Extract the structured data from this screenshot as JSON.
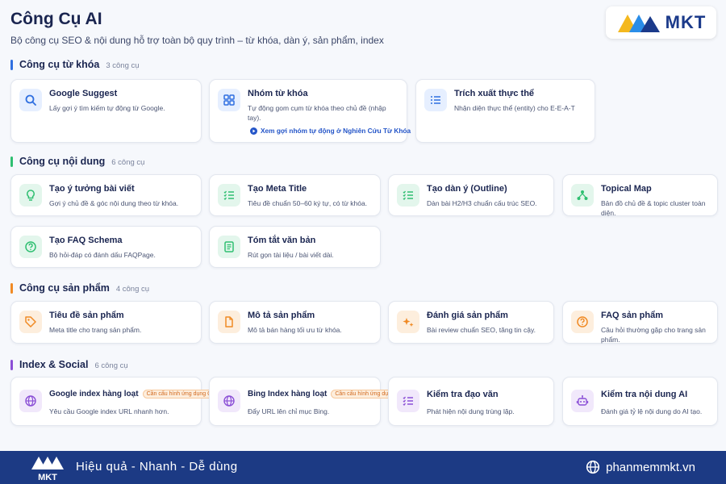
{
  "header": {
    "title": "Công Cụ AI",
    "subtitle": "Bộ công cụ SEO & nội dung hỗ trợ toàn bộ quy trình – từ khóa, dàn ý, sản phẩm, index",
    "logo_text": "MKT"
  },
  "colors": {
    "keyword": "#2f6fe0",
    "content": "#2fbf71",
    "product": "#f08a24",
    "index": "#8b4fd6",
    "footer_bg": "#1c3a84",
    "link": "#2455c8"
  },
  "sections": {
    "keyword": {
      "title": "Công cụ từ khóa",
      "count": "3 công cụ",
      "cards": [
        {
          "icon": "search-icon",
          "title": "Google Suggest",
          "desc": "Lấy gợi ý tìm kiếm tự động từ Google."
        },
        {
          "icon": "grid-icon",
          "title": "Nhóm từ khóa",
          "desc": "Tự động gom cụm từ khóa theo chủ đề (nhập tay).",
          "link": "Xem gợi nhóm tự động ở Nghiên Cứu Từ Khóa"
        },
        {
          "icon": "list-icon",
          "title": "Trích xuất thực thể",
          "desc": "Nhận diện thực thể (entity) cho E-E-A-T"
        }
      ]
    },
    "content": {
      "title": "Công cụ nội dung",
      "count": "6 công cụ",
      "cards": [
        {
          "icon": "lightbulb-icon",
          "title": "Tạo ý tưởng bài viết",
          "desc": "Gợi ý chủ đề & góc nội dung theo từ khóa."
        },
        {
          "icon": "checklist-icon",
          "title": "Tạo Meta Title",
          "desc": "Tiêu đề chuẩn 50–60 ký tự, có từ khóa."
        },
        {
          "icon": "checklist-icon",
          "title": "Tạo dàn ý (Outline)",
          "desc": "Dàn bài H2/H3 chuẩn cấu trúc SEO."
        },
        {
          "icon": "network-icon",
          "title": "Topical Map",
          "desc": "Bản đồ chủ đề & topic cluster toàn diện."
        },
        {
          "icon": "question-icon",
          "title": "Tạo FAQ Schema",
          "desc": "Bộ hỏi-đáp có đánh dấu FAQPage."
        },
        {
          "icon": "document-icon",
          "title": "Tóm tắt văn bản",
          "desc": "Rút gọn tài liệu / bài viết dài."
        }
      ]
    },
    "product": {
      "title": "Công cụ sản phẩm",
      "count": "4 công cụ",
      "cards": [
        {
          "icon": "tag-icon",
          "title": "Tiêu đề sản phẩm",
          "desc": "Meta title cho trang sản phẩm."
        },
        {
          "icon": "file-icon",
          "title": "Mô tả sản phẩm",
          "desc": "Mô tả bán hàng tối ưu từ khóa."
        },
        {
          "icon": "sparkle-icon",
          "title": "Đánh giá sản phẩm",
          "desc": "Bài review chuẩn SEO, tăng tin cậy."
        },
        {
          "icon": "question-icon",
          "title": "FAQ sản phẩm",
          "desc": "Câu hỏi thường gặp cho trang sản phẩm."
        }
      ]
    },
    "index": {
      "title": "Index & Social",
      "count": "6 công cụ",
      "cards": [
        {
          "icon": "globe-icon",
          "title": "Google index hàng loạt",
          "badge": "Cần cấu hình ứng dụng G",
          "desc": "Yêu cầu Google index URL nhanh hơn."
        },
        {
          "icon": "globe-icon",
          "title": "Bing Index hàng loạt",
          "badge": "Cần cấu hình ứng dụng B",
          "desc": "Đẩy URL lên chỉ mục Bing."
        },
        {
          "icon": "checklist-icon",
          "title": "Kiểm tra đạo văn",
          "desc": "Phát hiện nội dung trùng lặp."
        },
        {
          "icon": "robot-icon",
          "title": "Kiểm tra nội dung AI",
          "desc": "Đánh giá tỷ lệ nội dung do AI tạo."
        }
      ]
    }
  },
  "footer": {
    "logo_text": "MKT",
    "tagline": "Hiệu quả - Nhanh - Dễ dùng",
    "website": "phanmemmkt.vn"
  }
}
